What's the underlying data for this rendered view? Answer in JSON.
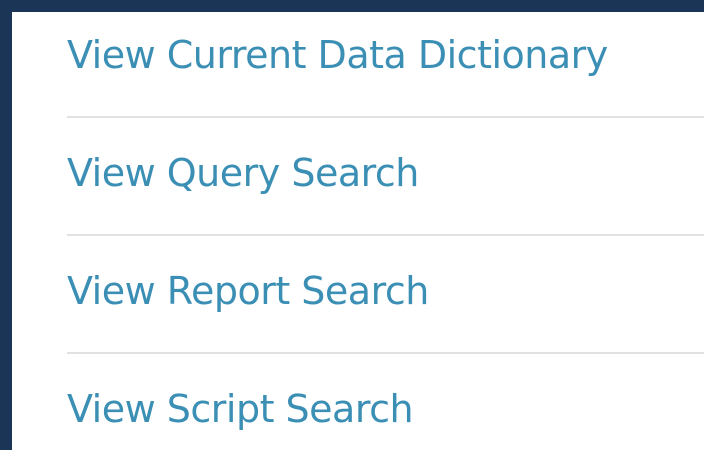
{
  "menu": {
    "items": [
      {
        "label": "View Current Data Dictionary"
      },
      {
        "label": "View Query Search"
      },
      {
        "label": "View Report Search"
      },
      {
        "label": "View Script Search"
      }
    ]
  },
  "colors": {
    "frame_border": "#1a3556",
    "link": "#3b8fb5",
    "divider": "#e1e1e1",
    "background": "#ffffff"
  }
}
